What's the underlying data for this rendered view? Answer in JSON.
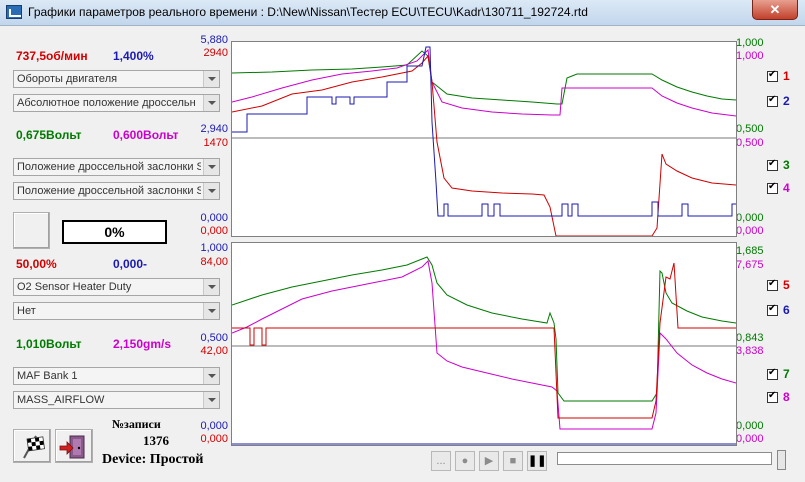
{
  "window": {
    "title": "Графики параметров реального времени : D:\\New\\Nissan\\Тестер ECU\\TECU\\Kadr\\130711_192724.rtd",
    "close_label": "✕"
  },
  "left_panel": {
    "group1": {
      "value_a": "737,5об/мин",
      "value_b": "1,400%",
      "combo_a": "Обороты двигателя",
      "combo_b": "Абсолютное положение дроссельн"
    },
    "group2": {
      "value_a": "0,675Вольт",
      "value_b": "0,600Вольт",
      "combo_a": "Положение дроссельной заслонки S",
      "combo_b": "Положение дроссельной заслонки S"
    },
    "percent_box": "0%",
    "group3": {
      "value_a": "50,00%",
      "value_b": "0,000-",
      "combo_a": "O2 Sensor Heater Duty",
      "combo_b": "Нет"
    },
    "group4": {
      "value_a": "1,010Вольт",
      "value_b": "2,150gm/s",
      "combo_a": "MAF Bank 1",
      "combo_b": "MASS_AIRFLOW"
    },
    "record_label": "№записи",
    "record_number": "1376",
    "device_label": "Device: Простой"
  },
  "chart_top": {
    "left_axis": {
      "max_a": "5,880",
      "max_b": "2940",
      "mid_a": "2,940",
      "mid_b": "1470",
      "min_a": "0,000",
      "min_b": "0,000"
    },
    "right_axis": {
      "max_a": "1,000",
      "max_b": "1,000",
      "mid_a": "0,500",
      "mid_b": "0,500",
      "min_a": "0,000",
      "min_b": "0,000"
    },
    "channels": [
      {
        "num": "1",
        "color": "#d00000"
      },
      {
        "num": "2",
        "color": "#1a1ab0"
      },
      {
        "num": "3",
        "color": "#007a00"
      },
      {
        "num": "4",
        "color": "#cc00cc"
      }
    ]
  },
  "chart_bottom": {
    "left_axis": {
      "max_a": "1,000",
      "max_b": "84,00",
      "mid_a": "0,500",
      "mid_b": "42,00",
      "min_a": "0,000",
      "min_b": "0,000"
    },
    "right_axis": {
      "max_a": "1,685",
      "max_b": "7,675",
      "mid_a": "0,843",
      "mid_b": "3,838",
      "min_a": "0,000",
      "min_b": "0,000"
    },
    "channels": [
      {
        "num": "5",
        "color": "#d00000"
      },
      {
        "num": "6",
        "color": "#1a1ab0"
      },
      {
        "num": "7",
        "color": "#007a00"
      },
      {
        "num": "8",
        "color": "#cc00cc"
      }
    ]
  },
  "player": {
    "browse": "...",
    "record": "●",
    "play": "▶",
    "stop": "■",
    "pause": "❚❚"
  }
}
